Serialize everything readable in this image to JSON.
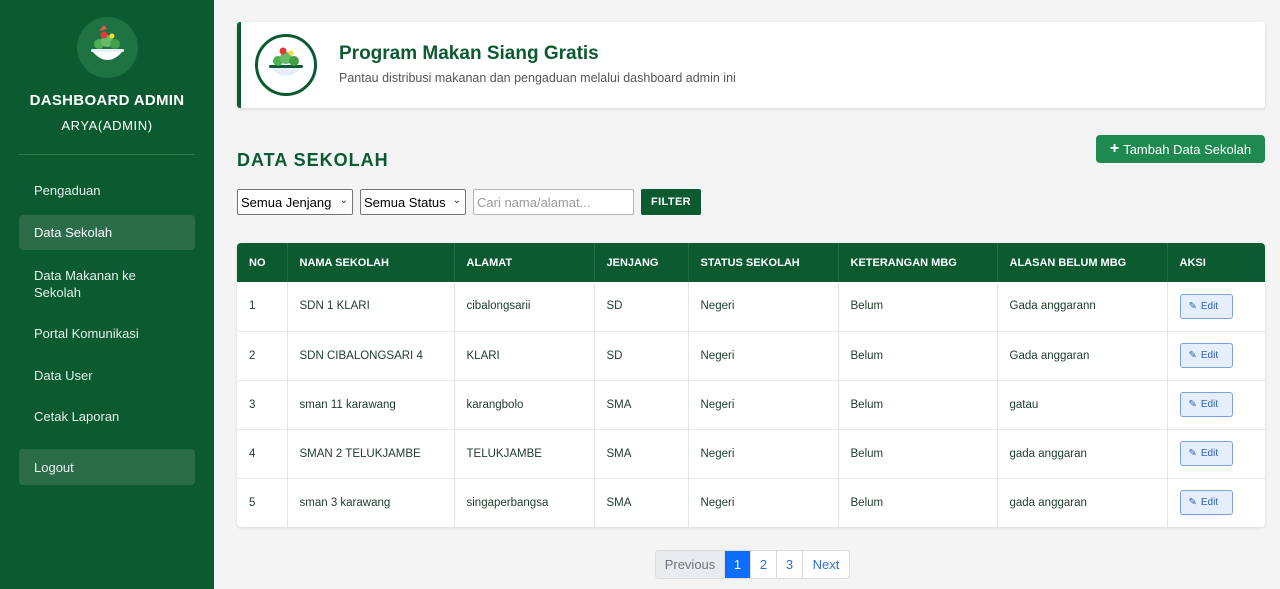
{
  "sidebar": {
    "title": "DASHBOARD ADMIN",
    "user": "ARYA(ADMIN)",
    "items": [
      {
        "label": "Pengaduan"
      },
      {
        "label": "Data Sekolah"
      },
      {
        "label": "Data Makanan ke Sekolah"
      },
      {
        "label": "Portal Komunikasi"
      },
      {
        "label": "Data User"
      },
      {
        "label": "Cetak Laporan"
      }
    ],
    "logout": "Logout",
    "active": "Data Sekolah"
  },
  "header": {
    "title": "Program Makan Siang Gratis",
    "subtitle": "Pantau distribusi makanan dan pengaduan melalui dashboard admin ini"
  },
  "section": {
    "title": "DATA SEKOLAH",
    "add_button": "Tambah Data Sekolah"
  },
  "filters": {
    "jenjang": "Semua Jenjang",
    "status": "Semua Status",
    "search_placeholder": "Cari nama/alamat...",
    "filter_button": "FILTER"
  },
  "table": {
    "headers": [
      "NO",
      "NAMA SEKOLAH",
      "ALAMAT",
      "JENJANG",
      "STATUS SEKOLAH",
      "KETERANGAN MBG",
      "ALASAN BELUM MBG",
      "AKSI"
    ],
    "rows": [
      {
        "no": "1",
        "nama": "SDN 1 KLARI",
        "alamat": "cibalongsarii",
        "jenjang": "SD",
        "status": "Negeri",
        "keterangan": "Belum",
        "alasan": "Gada anggarann",
        "aksi": "Edit"
      },
      {
        "no": "2",
        "nama": "SDN CIBALONGSARI 4",
        "alamat": "KLARI",
        "jenjang": "SD",
        "status": "Negeri",
        "keterangan": "Belum",
        "alasan": "Gada anggaran",
        "aksi": "Edit"
      },
      {
        "no": "3",
        "nama": "sman 11 karawang",
        "alamat": "karangbolo",
        "jenjang": "SMA",
        "status": "Negeri",
        "keterangan": "Belum",
        "alasan": "gatau",
        "aksi": "Edit"
      },
      {
        "no": "4",
        "nama": "SMAN 2 TELUKJAMBE",
        "alamat": "TELUKJAMBE",
        "jenjang": "SMA",
        "status": "Negeri",
        "keterangan": "Belum",
        "alasan": "gada anggaran",
        "aksi": "Edit"
      },
      {
        "no": "5",
        "nama": "sman 3 karawang",
        "alamat": "singaperbangsa",
        "jenjang": "SMA",
        "status": "Negeri",
        "keterangan": "Belum",
        "alasan": "gada anggaran",
        "aksi": "Edit"
      }
    ]
  },
  "pagination": {
    "previous": "Previous",
    "pages": [
      "1",
      "2",
      "3"
    ],
    "current": "1",
    "next": "Next"
  },
  "colors": {
    "brand": "#0b5a30",
    "accent": "#1e8a4f",
    "page_active": "#0d6efd"
  },
  "icons": {
    "logo": "salad-bowl-icon",
    "add": "plus-icon",
    "edit": "edit-icon",
    "dropdown": "chevron-down-icon"
  }
}
